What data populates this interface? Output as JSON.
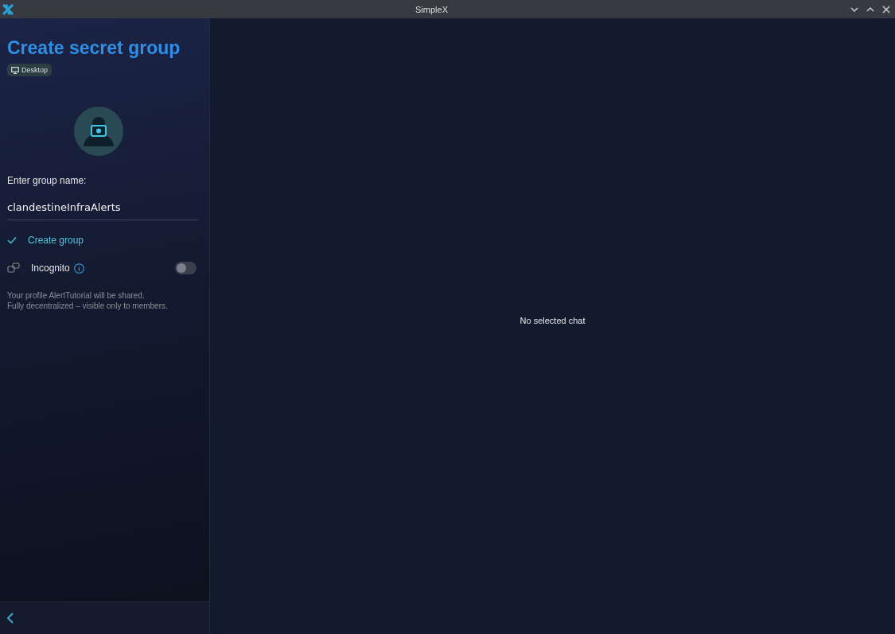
{
  "window": {
    "title": "SimpleX"
  },
  "panel": {
    "title": "Create secret group",
    "badge": "Desktop",
    "name_label": "Enter group name:",
    "name_value": "clandestineInfraAlerts",
    "create_label": "Create group",
    "incognito": {
      "label": "Incognito",
      "on": false
    },
    "notes": [
      "Your profile AlertTutorial will be shared.",
      "Fully decentralized – visible only to members."
    ]
  },
  "main": {
    "empty_text": "No selected chat"
  }
}
